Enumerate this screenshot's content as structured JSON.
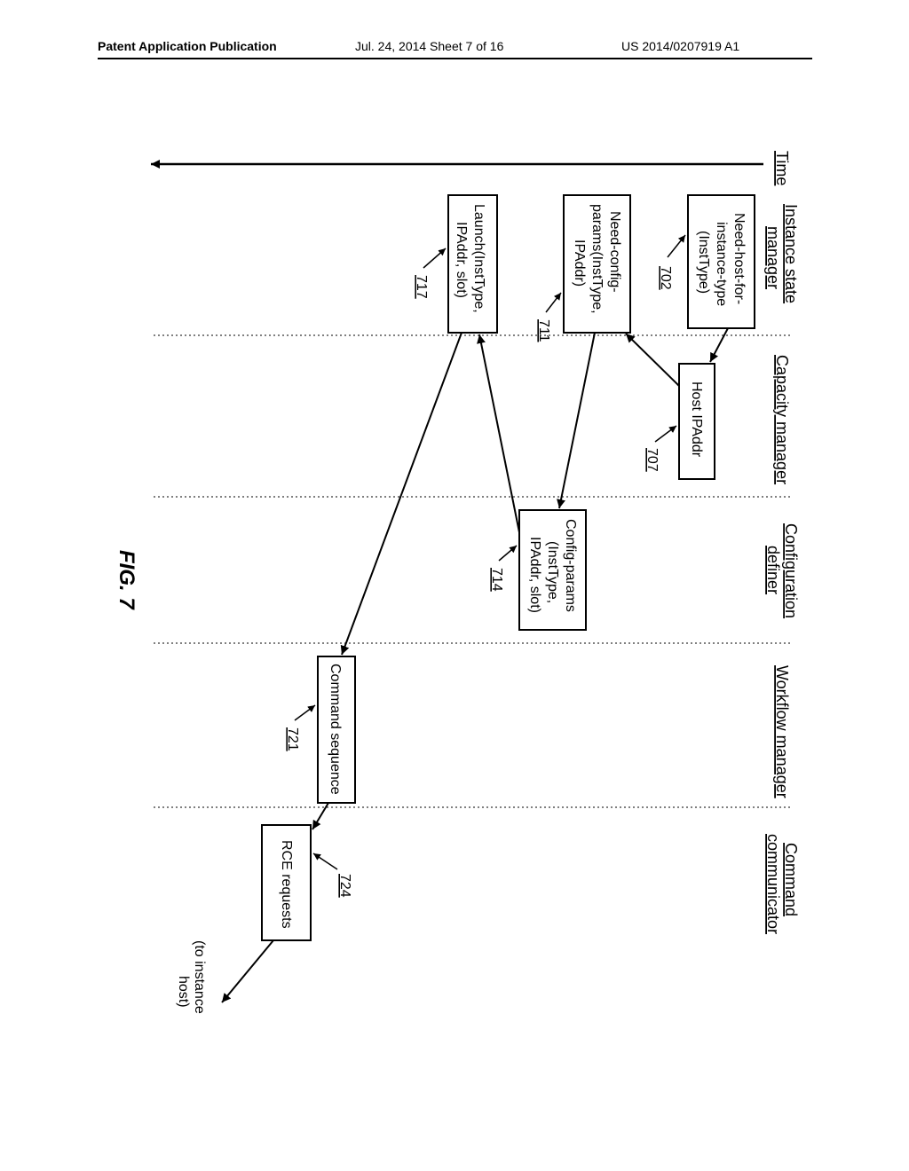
{
  "header": {
    "left": "Patent Application Publication",
    "center": "Jul. 24, 2014  Sheet 7 of 16",
    "right": "US 2014/0207919 A1"
  },
  "columns": {
    "c0": "Time",
    "c1": {
      "line1": "Instance state",
      "line2": "manager"
    },
    "c2": "Capacity manager",
    "c3": {
      "line1": "Configuration",
      "line2": "definer"
    },
    "c4": "Workflow manager",
    "c5": {
      "line1": "Command",
      "line2": "communicator"
    }
  },
  "boxes": {
    "b702": {
      "line1": "Need-host-for-",
      "line2": "instance-type",
      "line3": "(InstType)",
      "ref": "702"
    },
    "b707": {
      "line1": "Host IPAddr",
      "ref": "707"
    },
    "b711": {
      "line1": "Need-config-",
      "line2": "params(InstType,",
      "line3": "IPAddr)",
      "ref": "711"
    },
    "b714": {
      "line1": "Config-params",
      "line2": "(InstType,",
      "line3": "IPAddr, slot)",
      "ref": "714"
    },
    "b717": {
      "line1": "Launch(InstType,",
      "line2": "IPAddr, slot)",
      "ref": "717"
    },
    "b721": {
      "line1": "Command sequence",
      "ref": "721"
    },
    "b724": {
      "line1": "RCE requests",
      "ref": "724"
    }
  },
  "annotations": {
    "to_host": "(to instance host)"
  },
  "figure": "FIG. 7"
}
